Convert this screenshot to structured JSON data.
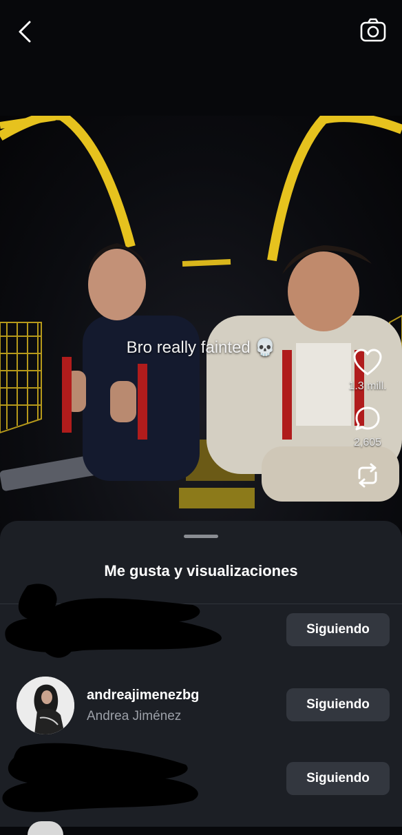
{
  "header": {
    "back_icon": "chevron-left-icon",
    "camera_icon": "camera-icon"
  },
  "video": {
    "caption": "Bro really fainted 💀",
    "likes_count": "1.3 mill.",
    "comments_count": "2,605",
    "like_icon": "heart-icon",
    "comment_icon": "comment-bubble-icon",
    "repost_icon": "repost-icon"
  },
  "sheet": {
    "title": "Me gusta y visualizaciones",
    "rows": [
      {
        "redacted": true,
        "button_label": "Siguiendo"
      },
      {
        "username": "andreajimenezbg",
        "full_name": "Andrea Jiménez",
        "button_label": "Siguiendo"
      },
      {
        "redacted": true,
        "button_label": "Siguiendo"
      }
    ]
  },
  "colors": {
    "background": "#07080b",
    "sheet": "#1c1f25",
    "button": "#33373f",
    "secondary_text": "#9ca0a8",
    "ride_frame": "#e6c21e"
  }
}
